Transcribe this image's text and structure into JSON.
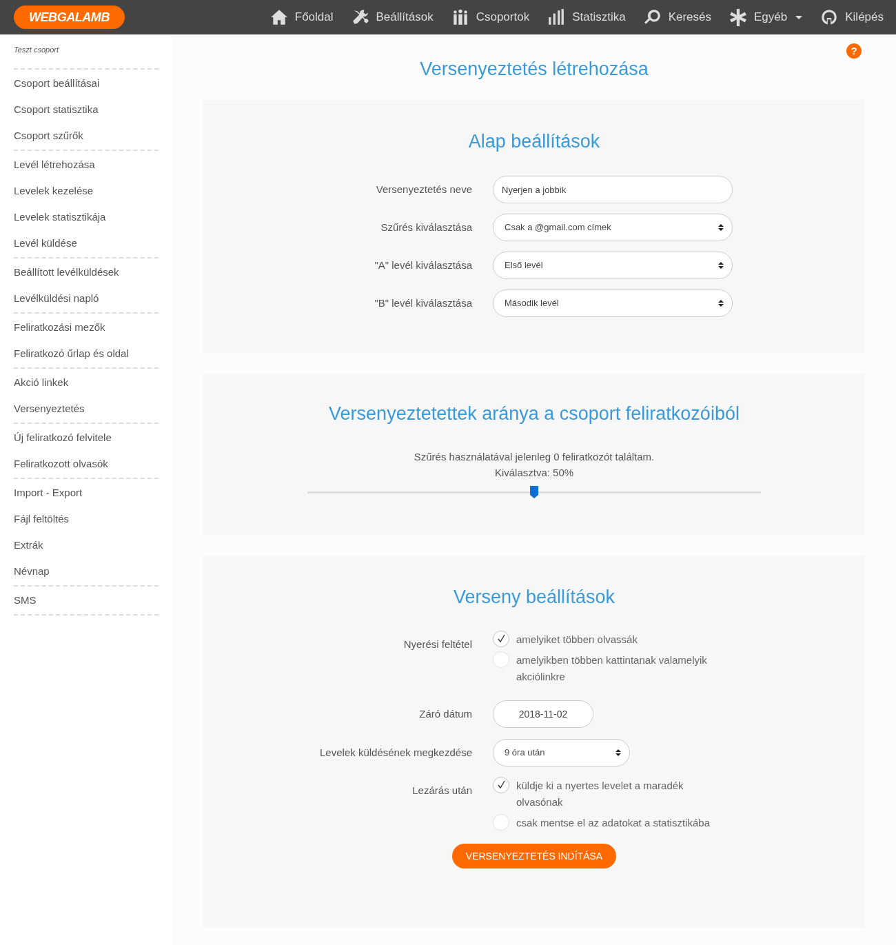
{
  "brand": {
    "logo": "WEBGALAMB"
  },
  "nav": [
    {
      "label": "Főoldal"
    },
    {
      "label": "Beállítások"
    },
    {
      "label": "Csoportok"
    },
    {
      "label": "Statisztika"
    },
    {
      "label": "Keresés"
    },
    {
      "label": "Egyéb"
    },
    {
      "label": "Kilépés"
    }
  ],
  "sidebar": {
    "group_name": "Teszt csoport",
    "groups": [
      [
        "Csoport beállításai",
        "Csoport statisztika",
        "Csoport szűrők"
      ],
      [
        "Levél létrehozása",
        "Levelek kezelése",
        "Levelek statisztikája",
        "Levél küldése"
      ],
      [
        "Beállított levélküldések",
        "Levélküldési napló"
      ],
      [
        "Feliratkozási mezők",
        "Feliratkozó űrlap és oldal"
      ],
      [
        "Akció linkek",
        "Versenyeztetés"
      ],
      [
        "Új feliratkozó felvitele",
        "Feliratkozott olvasók"
      ],
      [
        "Import - Export",
        "Fájl feltöltés",
        "Extrák",
        "Névnap"
      ],
      [
        "SMS"
      ]
    ]
  },
  "page_title": "Versenyeztetés létrehozása",
  "help": "?",
  "basic": {
    "title": "Alap beállítások",
    "fields": [
      {
        "label": "Versenyeztetés neve",
        "kind": "text",
        "value": "Nyerjen a jobbik"
      },
      {
        "label": "Szűrés kiválasztása",
        "kind": "select",
        "value": "Csak a @gmail.com címek"
      },
      {
        "label": "\"A\" levél kiválasztása",
        "kind": "select",
        "value": "Első levél"
      },
      {
        "label": "\"B\" levél kiválasztása",
        "kind": "select",
        "value": "Második levél"
      }
    ]
  },
  "ratio": {
    "title": "Versenyeztetettek aránya a csoport feliratkozóiból",
    "info": "Szűrés használatával jelenleg 0 feliratkozót találtam.",
    "selected_text": "Kiválasztva: 50%",
    "level": 0.5
  },
  "contest": {
    "title": "Verseny beállítások",
    "fields": [
      {
        "label": "Nyerési feltétel",
        "kind": "radio",
        "options": [
          {
            "label": "amelyiket többen olvassák",
            "selected": true
          },
          {
            "label": "amelyikben többen kattintanak valamelyik akciólinkre",
            "selected": false
          }
        ]
      },
      {
        "label": "Záró dátum",
        "kind": "date",
        "value": "2018-11-02"
      },
      {
        "label": "Levelek küldésének megkezdése",
        "kind": "select_small",
        "value": "9 óra után"
      },
      {
        "label": "Lezárás után",
        "kind": "radio",
        "options": [
          {
            "label": "küldje ki a nyertes levelet a maradék olvasónak",
            "selected": true
          },
          {
            "label": "csak mentse el az adatokat a statisztikába",
            "selected": false
          }
        ]
      }
    ],
    "submit": "VERSENYEZTETÉS INDÍTÁSA"
  }
}
